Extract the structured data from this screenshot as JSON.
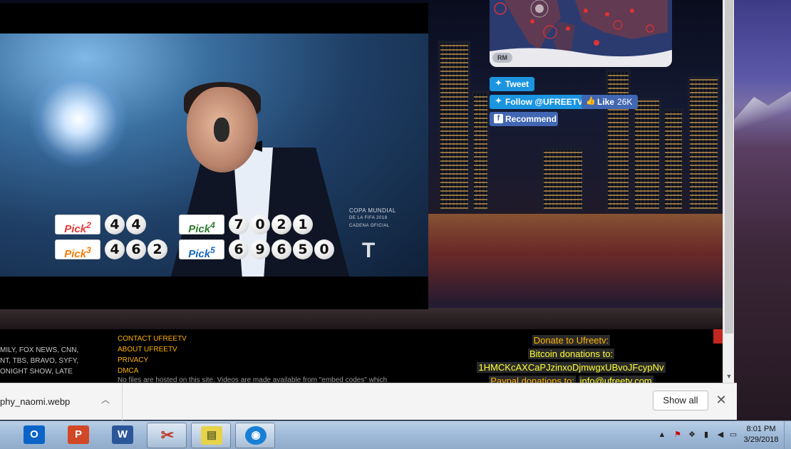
{
  "video": {
    "lottery": {
      "pick2": {
        "logo": "Pick",
        "num": "2",
        "digits": [
          "4",
          "4"
        ]
      },
      "pick3": {
        "logo": "Pick",
        "num": "3",
        "digits": [
          "4",
          "6",
          "2"
        ]
      },
      "pick4": {
        "logo": "Pick",
        "num": "4",
        "digits": [
          "7",
          "0",
          "2",
          "1"
        ]
      },
      "pick5": {
        "logo": "Pick",
        "num": "5",
        "digits": [
          "6",
          "9",
          "6",
          "5",
          "0"
        ]
      }
    },
    "watermark": {
      "line1": "COPA MUNDIAL",
      "line2": "DE LA FIFA 2018",
      "line3": "CADENA OFICIAL",
      "logo": "T"
    }
  },
  "map": {
    "badge": "RM"
  },
  "social": {
    "tweet_label": "Tweet",
    "follow_label": "Follow @UFREETV",
    "like_label": "Like",
    "like_count": "26K",
    "recommend_label": "Recommend"
  },
  "footer": {
    "categories": [
      "MILY, FOX NEWS, CNN,",
      "NT, TBS, BRAVO, SYFY,",
      "ONIGHT SHOW, LATE"
    ],
    "links": [
      "CONTACT UFREETV",
      "ABOUT UFREETV",
      "PRIVACY",
      "DMCA"
    ],
    "note": "No files are hosted on this site. Videos are made available from \"embed codes\" which",
    "donate_title": "Donate to Ufreetv:",
    "bitcoin_label": "Bitcoin donations to:",
    "bitcoin_address": "1HMCKcAXCaPJzinxoDjmwgxUBvoJFcypNv",
    "paypal_label": "Paypal donations to:",
    "paypal_email": "info@ufreetv.com"
  },
  "download_bar": {
    "file_name": "phy_naomi.webp",
    "show_all_label": "Show all"
  },
  "taskbar": {
    "apps": [
      {
        "name": "outlook-icon",
        "glyph": "O",
        "color": "#0a64c8"
      },
      {
        "name": "powerpoint-icon",
        "glyph": "P",
        "color": "#d24726"
      },
      {
        "name": "word-icon",
        "glyph": "W",
        "color": "#2b579a"
      },
      {
        "name": "snipping-tool-icon",
        "glyph": "✂",
        "color": "#c0392b"
      },
      {
        "name": "sticky-notes-icon",
        "glyph": "▤",
        "color": "#e6d34a"
      },
      {
        "name": "browser-shield-icon",
        "glyph": "◉",
        "color": "#1a7fd4"
      }
    ],
    "clock_time": "8:01 PM",
    "clock_date": "3/29/2018"
  }
}
